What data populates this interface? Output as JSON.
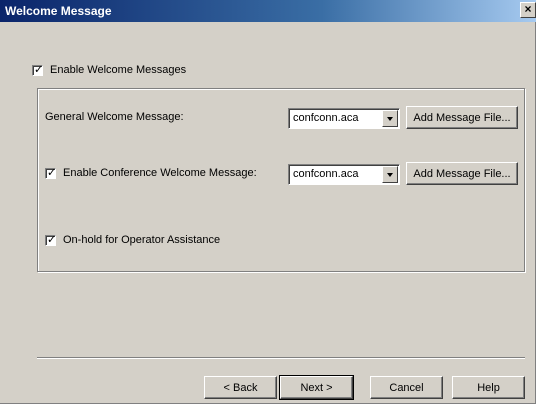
{
  "window": {
    "title": "Welcome Message",
    "close_glyph": "×"
  },
  "enable_welcome": {
    "label": "Enable Welcome Messages",
    "checked": true
  },
  "general": {
    "label": "General Welcome Message:",
    "value": "confconn.aca",
    "add_button": "Add Message File..."
  },
  "conference": {
    "label": "Enable Conference Welcome Message:",
    "checked": true,
    "value": "confconn.aca",
    "add_button": "Add Message File..."
  },
  "onhold": {
    "label": "On-hold for Operator Assistance",
    "checked": true
  },
  "footer": {
    "back": "< Back",
    "next": "Next >",
    "cancel": "Cancel",
    "help": "Help"
  },
  "check_glyph": "✓"
}
